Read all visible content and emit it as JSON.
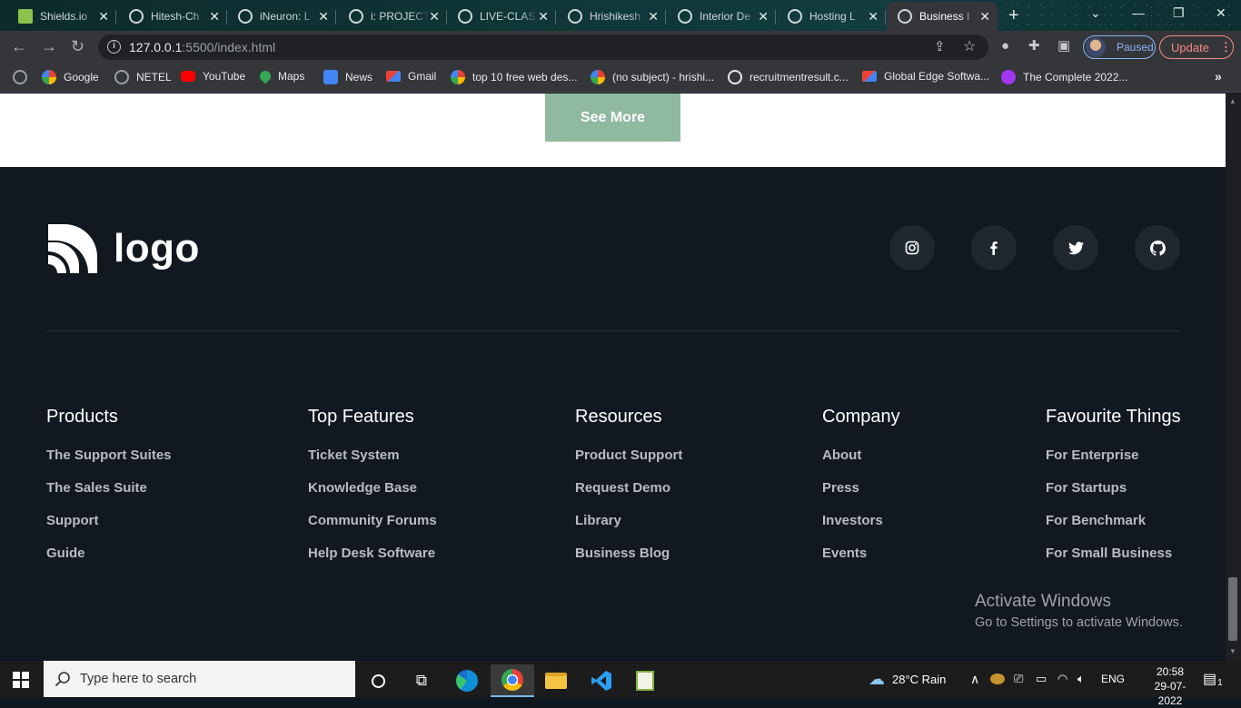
{
  "browser": {
    "tabs": [
      {
        "title": "Shields.io",
        "active": false
      },
      {
        "title": "Hitesh-Ch",
        "active": false
      },
      {
        "title": "iNeuron: L",
        "active": false
      },
      {
        "title": "i: PROJECT",
        "active": false
      },
      {
        "title": "LIVE-CLAS",
        "active": false
      },
      {
        "title": "Hrishikesh",
        "active": false
      },
      {
        "title": "Interior De",
        "active": false
      },
      {
        "title": "Hosting L",
        "active": false
      },
      {
        "title": "Business I",
        "active": true
      }
    ],
    "address": {
      "host": "127.0.0.1",
      "path": ":5500/index.html"
    },
    "profile_label": "Paused",
    "update_label": "Update",
    "bookmarks": [
      {
        "label": "Google",
        "icon": "google-icon",
        "color": "#4285f4"
      },
      {
        "label": "NETEL",
        "icon": "globe-icon",
        "color": "#9aa0a6"
      },
      {
        "label": "YouTube",
        "icon": "youtube-icon",
        "color": "#ff0000"
      },
      {
        "label": "Maps",
        "icon": "maps-pin-icon",
        "color": "#34a853"
      },
      {
        "label": "News",
        "icon": "news-icon",
        "color": "#4285f4"
      },
      {
        "label": "Gmail",
        "icon": "gmail-icon",
        "color": "#ea4335"
      },
      {
        "label": "top 10 free web des...",
        "icon": "google-icon",
        "color": "#4285f4"
      },
      {
        "label": "(no subject) - hrishi...",
        "icon": "google-icon",
        "color": "#4285f4"
      },
      {
        "label": "recruitmentresult.c...",
        "icon": "wordpress-icon",
        "color": "#e8eaed"
      },
      {
        "label": "Global Edge Softwa...",
        "icon": "gmail-icon",
        "color": "#ea4335"
      },
      {
        "label": "The Complete 2022...",
        "icon": "udemy-icon",
        "color": "#a435f0"
      }
    ]
  },
  "page": {
    "see_more_label": "See More",
    "logo_text": "logo",
    "social": [
      "instagram-icon",
      "facebook-icon",
      "twitter-icon",
      "github-icon"
    ],
    "columns": [
      {
        "heading": "Products",
        "links": [
          "The Support Suites",
          "The Sales Suite",
          "Support",
          "Guide"
        ]
      },
      {
        "heading": "Top Features",
        "links": [
          "Ticket System",
          "Knowledge Base",
          "Community Forums",
          "Help Desk Software"
        ]
      },
      {
        "heading": "Resources",
        "links": [
          "Product Support",
          "Request Demo",
          "Library",
          "Business Blog"
        ]
      },
      {
        "heading": "Company",
        "links": [
          "About",
          "Press",
          "Investors",
          "Events"
        ]
      },
      {
        "heading": "Favourite Things",
        "links": [
          "For Enterprise",
          "For Startups",
          "For Benchmark",
          "For Small Business"
        ]
      }
    ],
    "watermark": {
      "line1": "Activate Windows",
      "line2": "Go to Settings to activate Windows."
    }
  },
  "taskbar": {
    "search_placeholder": "Type here to search",
    "weather": "28°C  Rain",
    "language": "ENG",
    "time": "20:58",
    "date": "29-07-2022",
    "notification_count": "1"
  },
  "colors": {
    "footer_bg": "#111820",
    "button_bg": "#8fb9a0",
    "link_text": "#b7bcc2"
  }
}
